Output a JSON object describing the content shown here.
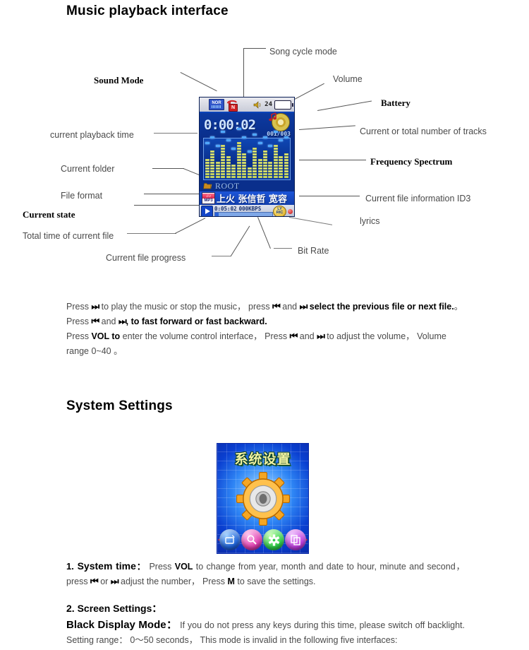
{
  "headings": {
    "music": "Music playback interface",
    "system": "System Settings"
  },
  "callouts": {
    "sound_mode": "Sound Mode",
    "song_cycle_mode": "Song cycle mode",
    "volume": "Volume",
    "battery": "Battery",
    "current_playback_time": "current playback time",
    "tracks": "Current or total number of tracks",
    "current_folder": "Current folder",
    "frequency_spectrum": "Frequency Spectrum",
    "file_format": "File format",
    "id3": "Current file information ID3",
    "current_state": "Current state",
    "lyrics": "lyrics",
    "total_time": "Total time of current file",
    "file_progress": "Current file progress",
    "bit_rate": "Bit Rate"
  },
  "device": {
    "sound_mode_icon": "NOR",
    "cycle_icon_letter": "N",
    "volume_value": "24",
    "playback_time": "0:00:02",
    "track_counter": "001/003",
    "folder_name": "ROOT",
    "file_format": "MP3",
    "id3_text": "上火 张信哲 宽容",
    "total_time": "0:05:02",
    "bit_rate": "000KBPS",
    "lyric_badge_line1": "LY",
    "lyric_badge_line2": "RIC",
    "spectrum_bars": [
      7,
      10,
      6,
      12,
      8,
      5,
      13,
      9,
      4,
      11,
      7,
      10,
      6,
      12,
      8,
      9
    ],
    "spectrum_peaks": [
      12,
      14,
      11,
      16,
      13,
      10,
      17,
      14,
      9,
      15,
      12,
      14,
      11,
      16,
      13,
      14
    ]
  },
  "paragraphs": {
    "playback_1_a": "Press ",
    "playback_1_key1": "⏭",
    "playback_1_b": " to play the music or stop the music， press ",
    "playback_1_key2": "⏮",
    "playback_1_c": " and ",
    "playback_1_key3": "⏭",
    "playback_1_d": " select the previous file or next file.",
    "playback_1_e": "。 Press ",
    "playback_1_key4": "⏮",
    "playback_1_f": " and ",
    "playback_1_key5": "⏭",
    "playback_1_g": ", to fast forward or fast backward.",
    "playback_2_a": "Press ",
    "playback_2_vol": "VOL to",
    "playback_2_b": " enter the volume control interface， Press ",
    "playback_2_key1": "⏮",
    "playback_2_c": " and ",
    "playback_2_key2": "⏭",
    "playback_2_d": " to adjust the volume， Volume range 0~40 。"
  },
  "system_screen": {
    "title": "系统设置",
    "icons": [
      "display-icon",
      "search-icon",
      "gear-icon",
      "copy-icon"
    ]
  },
  "settings": {
    "item1_num": "1.",
    "item1_title": " System time",
    "item1_colon": "：",
    "item1_a": "Press ",
    "item1_vol": "VOL",
    "item1_b": " to change  from year,  month  and  date  to hour,  minute  and second， press ",
    "item1_key1": "⏮",
    "item1_c": " or ",
    "item1_key2": "⏭",
    "item1_d": " adjust the number， Press ",
    "item1_m": "M",
    "item1_e": " to save the settings.",
    "item2_title": "2. Screen Settings：",
    "item3_title": "Black Display Mode：",
    "item3_body": " If you do not press any keys during this time, please switch off backlight. Setting range： 0～50 seconds， This mode is invalid in the following five interfaces:"
  },
  "colors": {
    "screen_blue": "#0a2f8c",
    "accent_blue": "#1446c8",
    "spectrum_yellow": "#dfe77a",
    "peak_blue": "#4fa8ff",
    "red": "#cf1f22"
  }
}
